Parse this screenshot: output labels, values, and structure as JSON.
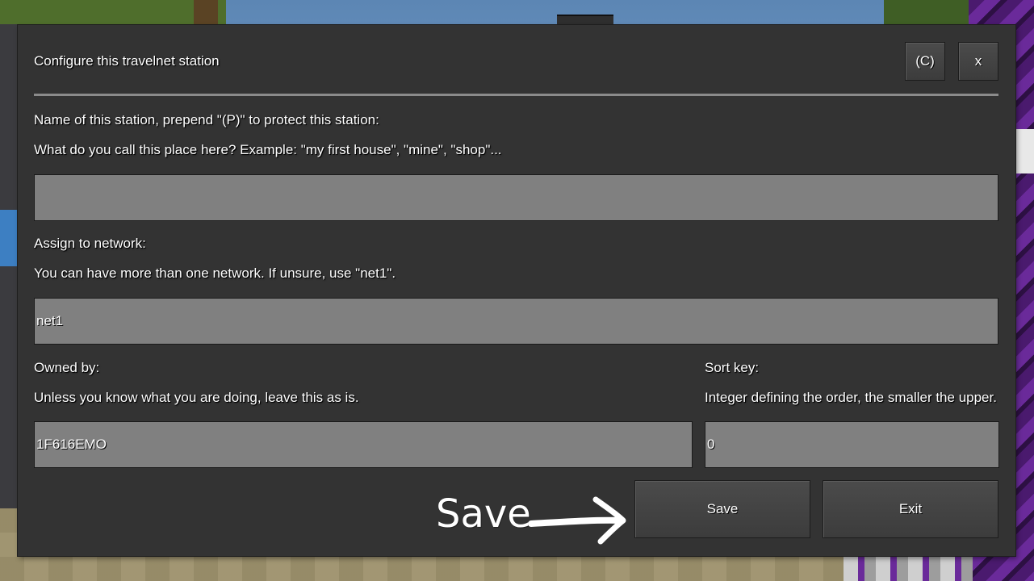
{
  "dialog": {
    "title": "Configure this travelnet station",
    "credits_button": "(C)",
    "close_button": "x"
  },
  "station_name": {
    "label": "Name of this station, prepend \"(P)\" to protect this station:",
    "help": "What do you call this place here? Example: \"my first house\", \"mine\", \"shop\"...",
    "value": ""
  },
  "network": {
    "label": "Assign to network:",
    "help": "You can have more than one network. If unsure, use \"net1\".",
    "value": "net1"
  },
  "owner": {
    "label": "Owned by:",
    "help": "Unless you know what you are doing, leave this as is.",
    "value": "1F616EMO"
  },
  "sort_key": {
    "label": "Sort key:",
    "help": "Integer defining the order, the smaller the upper.",
    "value": "0"
  },
  "actions": {
    "save": "Save",
    "exit": "Exit"
  },
  "annotation": {
    "text": "Save",
    "icon": "hand-drawn-arrow-icon",
    "color": "#ffffff"
  }
}
